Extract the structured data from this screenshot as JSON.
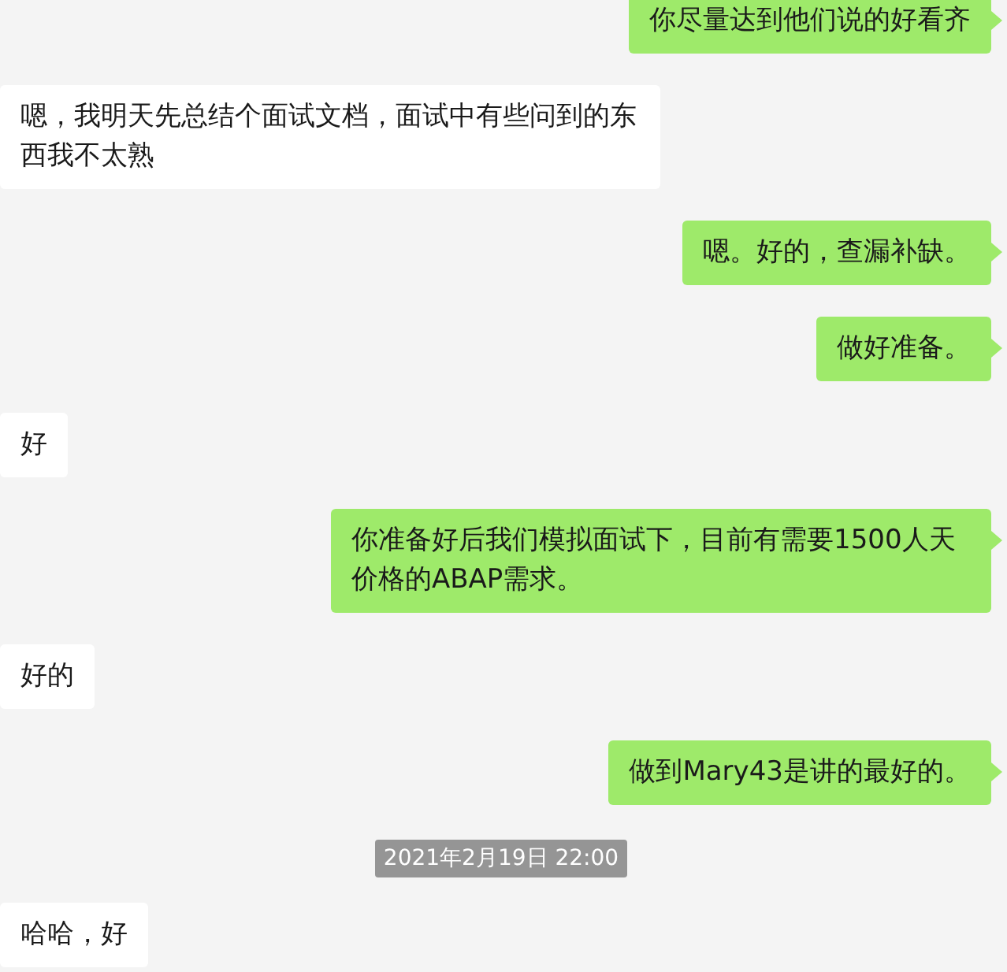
{
  "messages": [
    {
      "kind": "message",
      "sent": true,
      "text": "你尽量达到他们说的好看齐"
    },
    {
      "kind": "message",
      "sent": false,
      "text": "嗯，我明天先总结个面试文档，面试中有些问到的东西我不太熟"
    },
    {
      "kind": "message",
      "sent": true,
      "text": "嗯。好的，查漏补缺。"
    },
    {
      "kind": "message",
      "sent": true,
      "text": "做好准备。"
    },
    {
      "kind": "message",
      "sent": false,
      "text": "好"
    },
    {
      "kind": "message",
      "sent": true,
      "text": "你准备好后我们模拟面试下，目前有需要1500人天价格的ABAP需求。"
    },
    {
      "kind": "message",
      "sent": false,
      "text": "好的"
    },
    {
      "kind": "message",
      "sent": true,
      "text": "做到Mary43是讲的最好的。"
    },
    {
      "kind": "timestamp",
      "text": "2021年2月19日 22:00"
    },
    {
      "kind": "message",
      "sent": false,
      "text": "哈哈，好"
    }
  ]
}
